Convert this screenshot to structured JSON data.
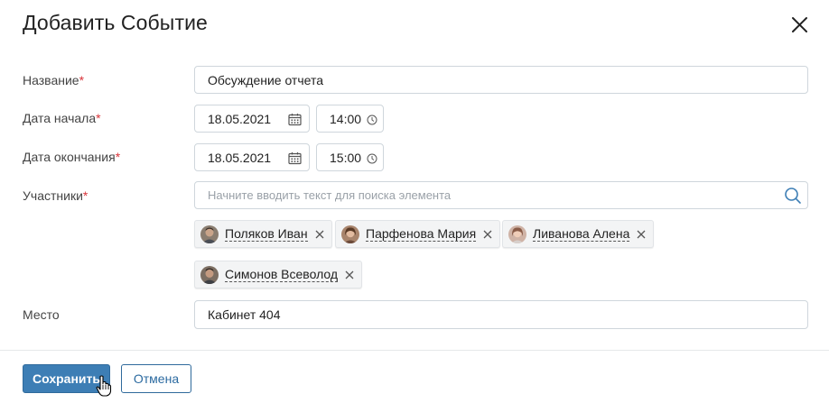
{
  "dialog": {
    "title": "Добавить Событие",
    "close_icon": "close-icon"
  },
  "form": {
    "name": {
      "label": "Название",
      "required_mark": "*",
      "value": "Обсуждение отчета"
    },
    "start": {
      "label": "Дата начала",
      "required_mark": "*",
      "date": "18.05.2021",
      "time": "14:00"
    },
    "end": {
      "label": "Дата окончания",
      "required_mark": "*",
      "date": "18.05.2021",
      "time": "15:00"
    },
    "participants": {
      "label": "Участники",
      "required_mark": "*",
      "placeholder": "Начните вводить текст для поиска элемента",
      "chips": [
        {
          "name": "Поляков Иван",
          "avatar_color": "#7a6a5a"
        },
        {
          "name": "Парфенова Мария",
          "avatar_color": "#9a7058"
        },
        {
          "name": "Ливанова Алена",
          "avatar_color": "#b8887a"
        },
        {
          "name": "Симонов Всеволод",
          "avatar_color": "#6c5c50"
        }
      ]
    },
    "place": {
      "label": "Место",
      "value": "Кабинет 404"
    }
  },
  "footer": {
    "save_label": "Сохранить",
    "cancel_label": "Отмена"
  },
  "colors": {
    "primary": "#3d7eb5",
    "required": "#d9343a",
    "border": "#cfd6dc"
  }
}
